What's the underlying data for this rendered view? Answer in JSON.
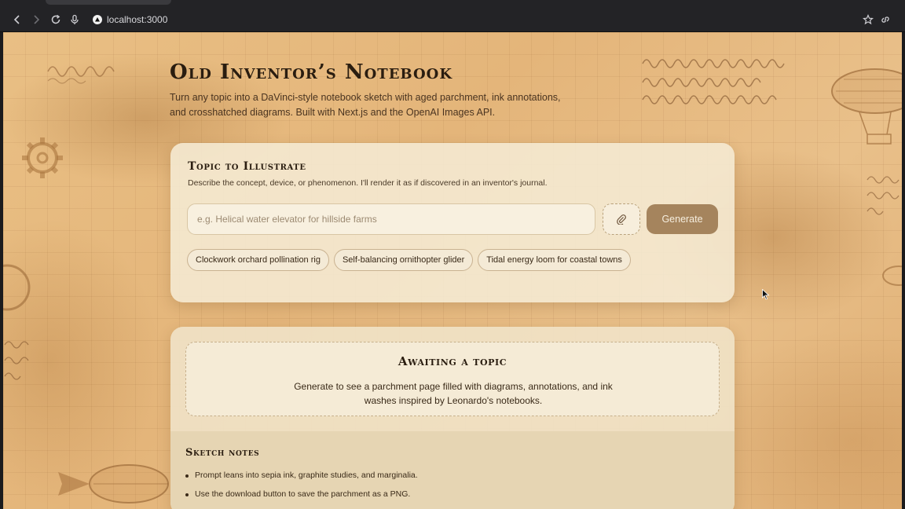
{
  "browser": {
    "url": "localhost:3000"
  },
  "header": {
    "title": "Old Inventor’s Notebook",
    "description": "Turn any topic into a DaVinci-style notebook sketch with aged parchment, ink annotations, and crosshatched diagrams. Built with Next.js and the OpenAI Images API."
  },
  "topic": {
    "title": "Topic to Illustrate",
    "subtitle": "Describe the concept, device, or phenomenon. I'll render it as if discovered in an inventor's journal.",
    "input_placeholder": "e.g. Helical water elevator for hillside farms",
    "input_value": "",
    "generate_label": "Generate",
    "chips": [
      "Clockwork orchard pollination rig",
      "Self-balancing ornithopter glider",
      "Tidal energy loom for coastal towns"
    ]
  },
  "result": {
    "awaiting_title": "Awaiting a topic",
    "awaiting_text": "Generate to see a parchment page filled with diagrams, annotations, and ink washes inspired by Leonardo's notebooks."
  },
  "notes": {
    "title": "Sketch notes",
    "items": [
      "Prompt leans into sepia ink, graphite studies, and marginalia.",
      "Use the download button to save the parchment as a PNG."
    ]
  },
  "icons": {
    "back": "arrow-left-icon",
    "forward": "arrow-right-icon",
    "reload": "reload-icon",
    "mic": "microphone-icon",
    "bookmark": "star-icon",
    "share": "link-icon",
    "attach": "paperclip-icon"
  },
  "colors": {
    "parchment": "#e9bf84",
    "card": "#f5ead4",
    "generate_button": "#a5845d",
    "ink": "#2a1d10"
  }
}
